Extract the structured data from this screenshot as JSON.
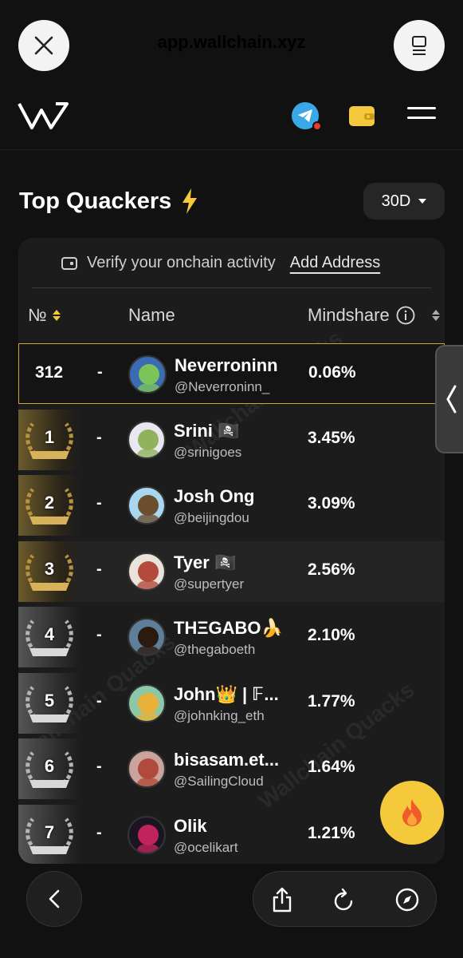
{
  "browser": {
    "url": "app.wallchain.xyz",
    "close_icon": "close-icon",
    "tabs_icon": "tabs-icon"
  },
  "header": {
    "icons": [
      "telegram-icon",
      "wallet-icon",
      "menu-icon"
    ]
  },
  "page": {
    "title": "Top Quackers",
    "period": "30D"
  },
  "card": {
    "verify_text": "Verify your onchain activity",
    "add_address": "Add Address",
    "columns": {
      "no": "№",
      "name": "Name",
      "mindshare": "Mindshare"
    }
  },
  "rows": [
    {
      "rank": "312",
      "change": "-",
      "name": "Neverroninn",
      "handle": "@Neverroninn_",
      "share": "0.06%",
      "medal": "none"
    },
    {
      "rank": "1",
      "change": "-",
      "name": "Srini 🏴‍☠️",
      "handle": "@srinigoes",
      "share": "3.45%",
      "medal": "gold"
    },
    {
      "rank": "2",
      "change": "-",
      "name": "Josh Ong",
      "handle": "@beijingdou",
      "share": "3.09%",
      "medal": "gold"
    },
    {
      "rank": "3",
      "change": "-",
      "name": "Tyer 🏴‍☠️",
      "handle": "@supertyer",
      "share": "2.56%",
      "medal": "gold"
    },
    {
      "rank": "4",
      "change": "-",
      "name": "THΞGABO🍌",
      "handle": "@thegaboeth",
      "share": "2.10%",
      "medal": "silver"
    },
    {
      "rank": "5",
      "change": "-",
      "name": "John👑 | 𝔽...",
      "handle": "@johnking_eth",
      "share": "1.77%",
      "medal": "silver"
    },
    {
      "rank": "6",
      "change": "-",
      "name": "bisasam.et...",
      "handle": "@SailingCloud",
      "share": "1.64%",
      "medal": "silver"
    },
    {
      "rank": "7",
      "change": "-",
      "name": "Olik",
      "handle": "@ocelikart",
      "share": "1.21%",
      "medal": "silver"
    }
  ],
  "colors": {
    "accent_gold": "#c9a63b",
    "fab": "#f5c93c",
    "telegram": "#3aa7e6",
    "wallet": "#f5c93c"
  },
  "fab": {
    "icon": "fire-icon"
  },
  "bottom_bar": {
    "icons": [
      "back-icon",
      "share-icon",
      "reload-icon",
      "compass-icon"
    ]
  },
  "watermark": "Wallchain Quacks"
}
